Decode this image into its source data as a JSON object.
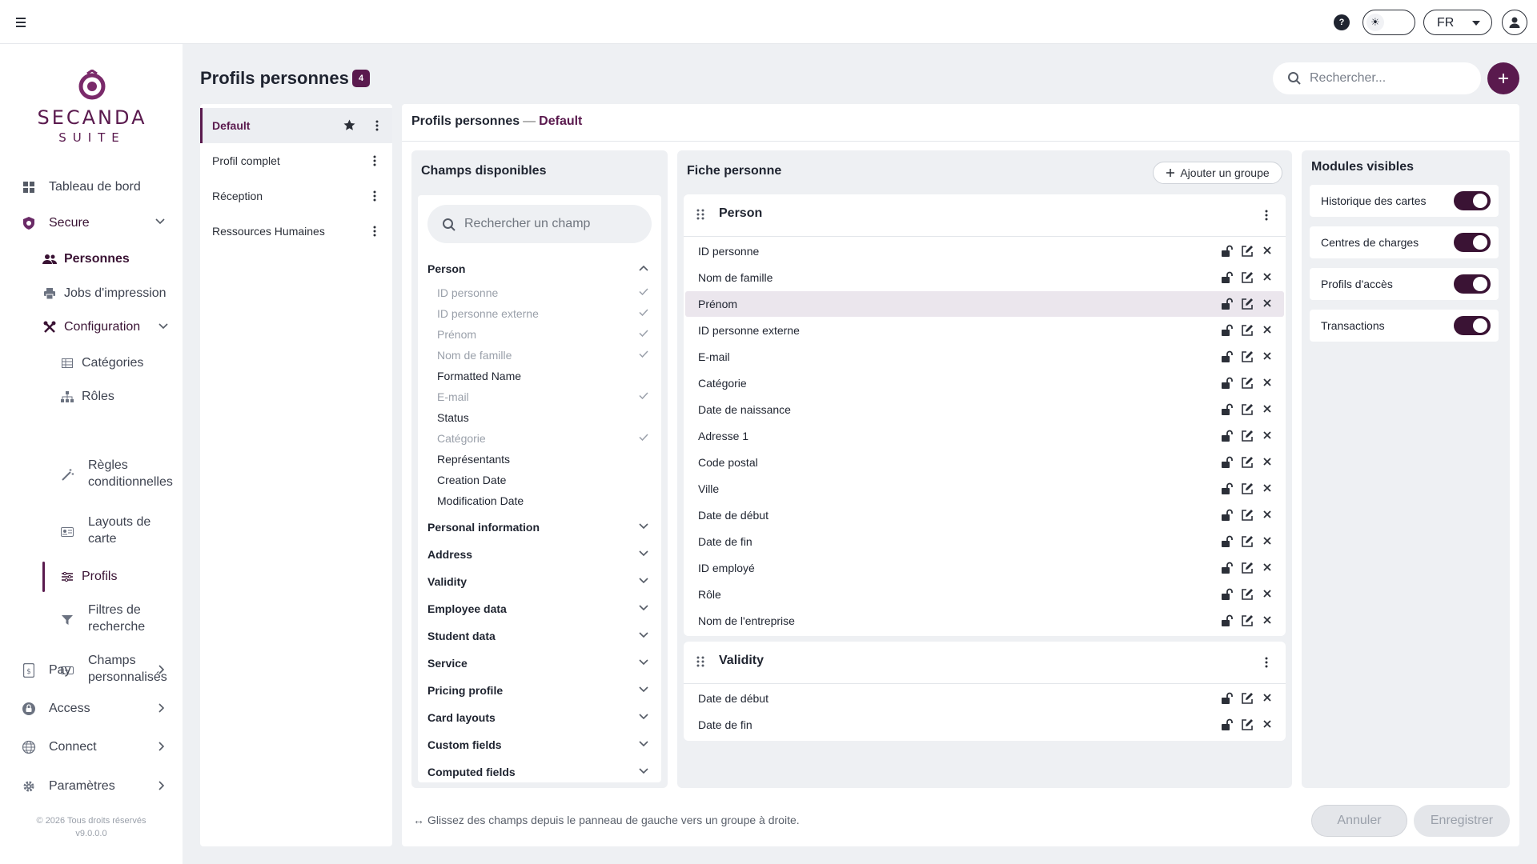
{
  "topbar": {
    "menu_icon": "hamburger-icon",
    "help_label": "?",
    "theme_icon": "sun-icon",
    "language": "FR",
    "user_icon": "user-circle-icon"
  },
  "brand": {
    "name": "SECANDA",
    "suite": "SUITE",
    "color": "#5a1a4e"
  },
  "sidebar": {
    "items": [
      {
        "label": "Tableau de bord",
        "icon": "dashboard-icon"
      },
      {
        "label": "Secure",
        "icon": "shield-icon"
      },
      {
        "label": "Personnes",
        "icon": "people-icon"
      },
      {
        "label": "Jobs d'impression",
        "icon": "printer-icon"
      },
      {
        "label": "Configuration",
        "icon": "tools-icon"
      },
      {
        "label": "Catégories",
        "icon": "table-icon"
      },
      {
        "label": "Rôles",
        "icon": "hierarchy-icon"
      },
      {
        "label": "Règles conditionnelles",
        "icon": "magic-wand-icon"
      },
      {
        "label": "Layouts de carte",
        "icon": "id-card-icon"
      },
      {
        "label": "Profils",
        "icon": "sliders-icon"
      },
      {
        "label": "Filtres de recherche",
        "icon": "filter-icon"
      },
      {
        "label": "Champs personnalisés",
        "icon": "input-icon"
      },
      {
        "label": "Pay",
        "icon": "wallet-icon"
      },
      {
        "label": "Access",
        "icon": "lock-icon"
      },
      {
        "label": "Connect",
        "icon": "globe-icon"
      },
      {
        "label": "Paramètres",
        "icon": "gear-icon"
      }
    ],
    "footer_copyright": "© 2026 Tous droits réservés",
    "footer_version": "v9.0.0.0"
  },
  "header": {
    "title": "Profils personnes",
    "count": "4",
    "search_placeholder": "Rechercher...",
    "add_icon": "plus-icon"
  },
  "profiles": [
    {
      "label": "Default",
      "active": true
    },
    {
      "label": "Profil complet"
    },
    {
      "label": "Réception"
    },
    {
      "label": "Ressources Humaines"
    }
  ],
  "breadcrumb": {
    "section": "Profils personnes",
    "separator": "—",
    "current": "Default"
  },
  "available": {
    "title": "Champs disponibles",
    "search_placeholder": "Rechercher un champ",
    "expanded_group": "Person",
    "fields": [
      {
        "label": "ID personne",
        "used": true
      },
      {
        "label": "ID personne externe",
        "used": true
      },
      {
        "label": "Prénom",
        "used": true
      },
      {
        "label": "Nom de famille",
        "used": true
      },
      {
        "label": "Formatted Name",
        "used": false
      },
      {
        "label": "E-mail",
        "used": true
      },
      {
        "label": "Status",
        "used": false
      },
      {
        "label": "Catégorie",
        "used": true
      },
      {
        "label": "Représentants",
        "used": false
      },
      {
        "label": "Creation Date",
        "used": false
      },
      {
        "label": "Modification Date",
        "used": false
      }
    ],
    "groups": [
      "Personal information",
      "Address",
      "Validity",
      "Employee data",
      "Student data",
      "Service",
      "Pricing profile",
      "Card layouts",
      "Custom fields",
      "Computed fields"
    ]
  },
  "form": {
    "title": "Fiche personne",
    "add_group_label": "Ajouter un groupe",
    "groups": [
      {
        "title": "Person",
        "fields": [
          "ID personne",
          "Nom de famille",
          "Prénom",
          "ID personne externe",
          "E-mail",
          "Catégorie",
          "Date de naissance",
          "Adresse 1",
          "Code postal",
          "Ville",
          "Date de début",
          "Date de fin",
          "ID employé",
          "Rôle",
          "Nom de l'entreprise"
        ],
        "highlighted_index": 2
      },
      {
        "title": "Validity",
        "fields": [
          "Date de début",
          "Date de fin"
        ]
      }
    ]
  },
  "modules": {
    "title": "Modules visibles",
    "items": [
      {
        "label": "Historique des cartes",
        "enabled": true
      },
      {
        "label": "Centres de charges",
        "enabled": true
      },
      {
        "label": "Profils d'accès",
        "enabled": true
      },
      {
        "label": "Transactions",
        "enabled": true
      }
    ]
  },
  "footer": {
    "hint_icon": "swap-arrows-icon",
    "hint": "Glissez des champs depuis le panneau de gauche vers un groupe à droite.",
    "cancel_label": "Annuler",
    "save_label": "Enregistrer"
  }
}
